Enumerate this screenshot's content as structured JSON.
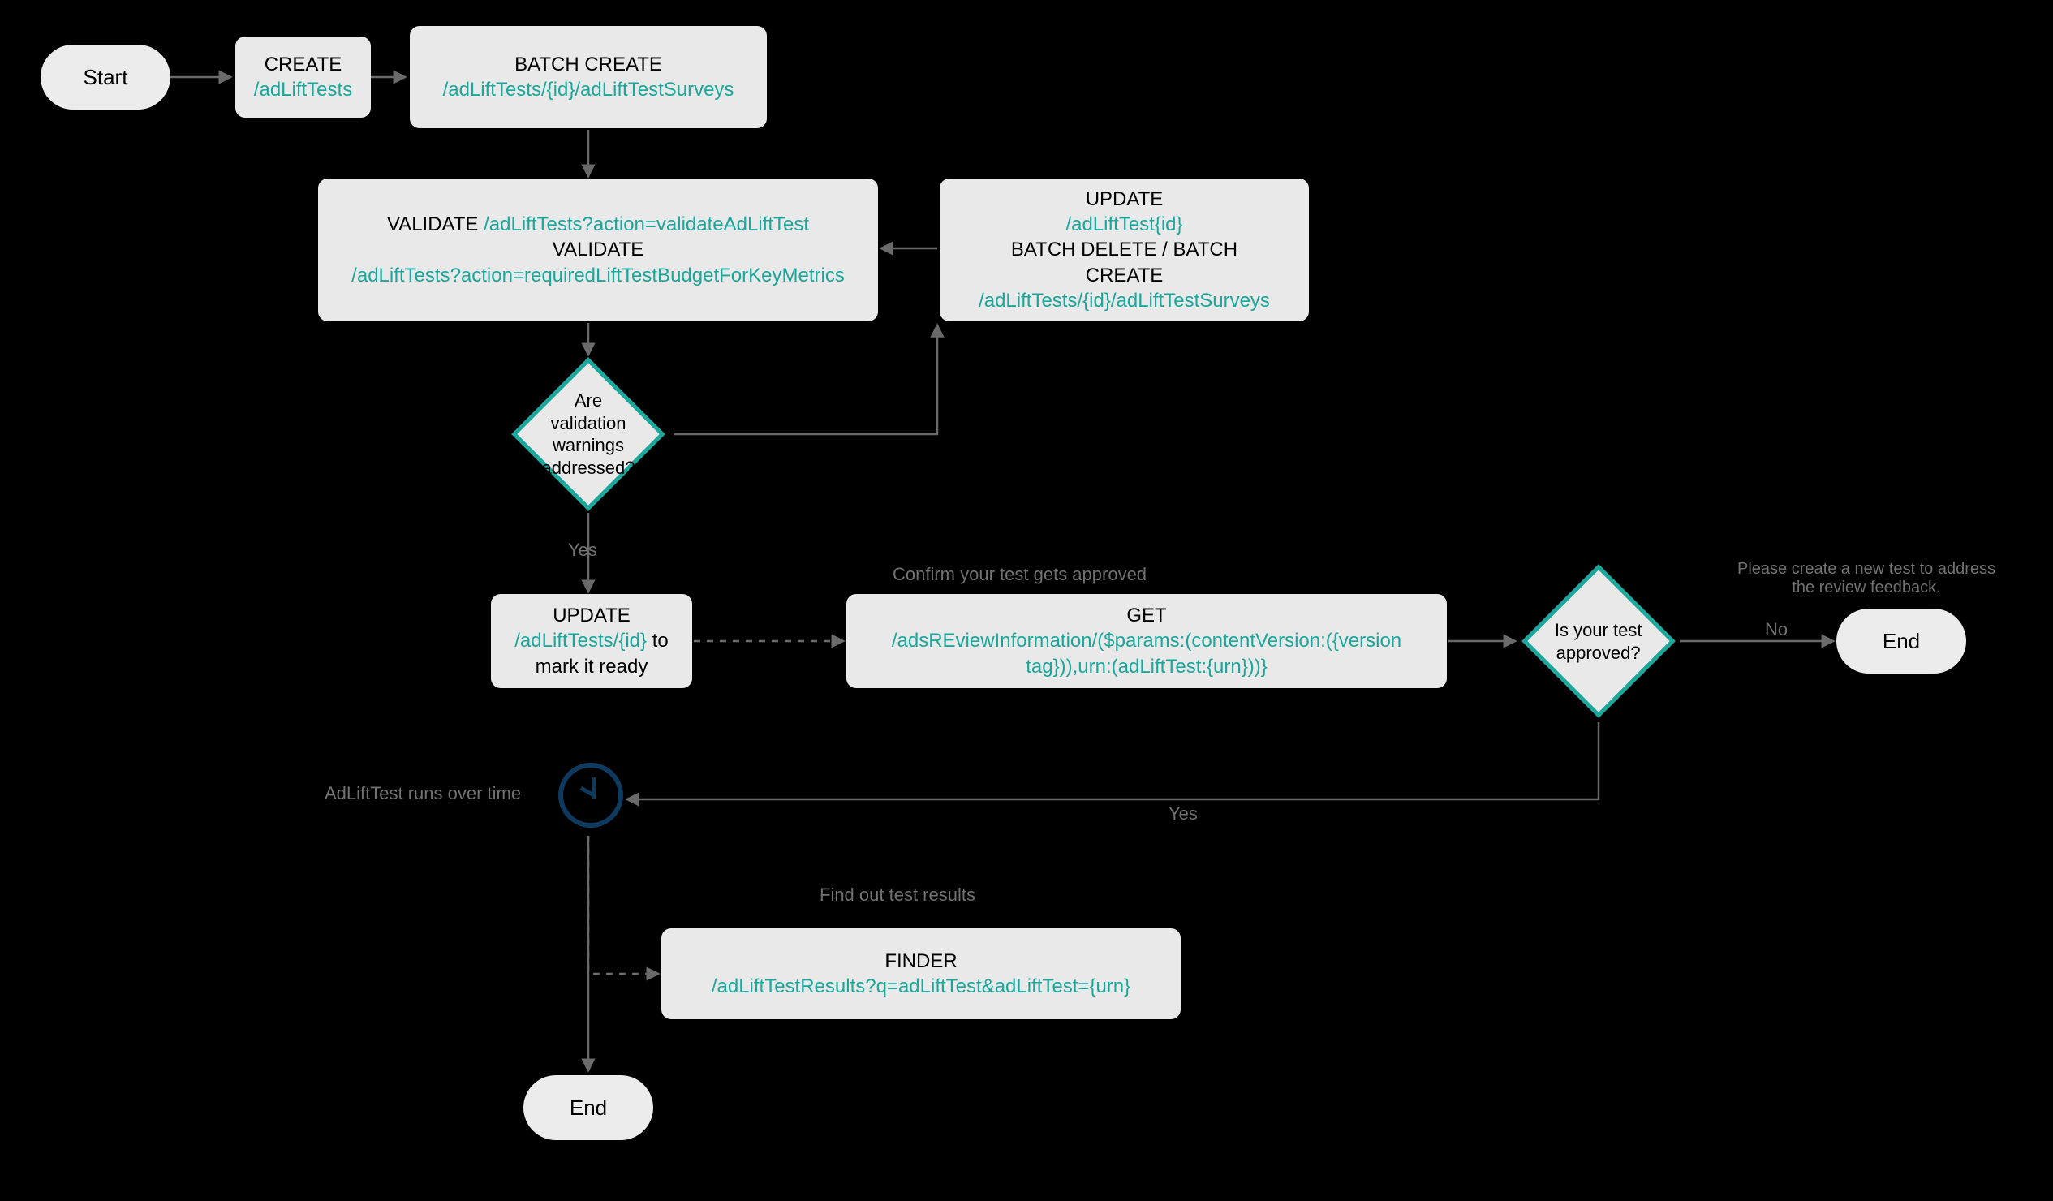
{
  "colors": {
    "bg": "#000000",
    "node_bg": "#e9e9e9",
    "accent": "#1aa79c",
    "edge": "#6a6a6a",
    "edge_dashed": "#6a6a6a",
    "label_gray": "#717171",
    "clock": "#0f3a5f"
  },
  "nodes": {
    "start": {
      "label": "Start"
    },
    "create": {
      "title": "CREATE",
      "path": "/adLiftTests"
    },
    "batch_create": {
      "title": "BATCH CREATE",
      "path": "/adLiftTests/{id}/adLiftTestSurveys"
    },
    "validate": {
      "line1_pre": "VALIDATE ",
      "line1_path": "/adLiftTests?action=validateAdLiftTest",
      "line2": "VALIDATE",
      "line3_path": "/adLiftTests?action=requiredLiftTestBudgetForKeyMetrics"
    },
    "update_batch": {
      "line1": "UPDATE",
      "line1_path": "/adLiftTest{id}",
      "line2": "BATCH DELETE / BATCH CREATE",
      "line2_path": "/adLiftTests/{id}/adLiftTestSurveys"
    },
    "decision_warnings": {
      "text": "Are validation warnings addressed?"
    },
    "update_ready": {
      "line1": "UPDATE",
      "path": "/adLiftTests/{id}",
      "suffix": " to mark it ready"
    },
    "get_review": {
      "line1": "GET",
      "path": "/adsREviewInformation/($params:(contentVersion:({version tag})),urn:(adLiftTest:{urn}))}"
    },
    "decision_approved": {
      "text": "Is your test approved?"
    },
    "end_right": {
      "label": "End"
    },
    "finder": {
      "line1": "FINDER",
      "path": "/adLiftTestResults?q=adLiftTest&adLiftTest={urn}"
    },
    "end_bottom": {
      "label": "End"
    }
  },
  "edge_labels": {
    "yes_down": "Yes",
    "confirm": "Confirm your test gets approved",
    "no_right": "No",
    "feedback": "Please create a new test to address the review feedback.",
    "yes_back": "Yes",
    "runs_over_time": "AdLiftTest runs over time",
    "find_results": "Find out test results"
  },
  "chart_data": {
    "type": "flowchart",
    "title": "",
    "nodes": [
      {
        "id": "start",
        "kind": "terminal",
        "label": "Start"
      },
      {
        "id": "create",
        "kind": "process",
        "label": "CREATE /adLiftTests"
      },
      {
        "id": "batch_create",
        "kind": "process",
        "label": "BATCH CREATE /adLiftTests/{id}/adLiftTestSurveys"
      },
      {
        "id": "validate",
        "kind": "process",
        "label": "VALIDATE /adLiftTests?action=validateAdLiftTest; VALIDATE /adLiftTests?action=requiredLiftTestBudgetForKeyMetrics"
      },
      {
        "id": "update_batch",
        "kind": "process",
        "label": "UPDATE /adLiftTest{id}; BATCH DELETE / BATCH CREATE /adLiftTests/{id}/adLiftTestSurveys"
      },
      {
        "id": "decision_warnings",
        "kind": "decision",
        "label": "Are validation warnings addressed?"
      },
      {
        "id": "update_ready",
        "kind": "process",
        "label": "UPDATE /adLiftTests/{id} to mark it ready"
      },
      {
        "id": "get_review",
        "kind": "process",
        "label": "GET /adsREviewInformation/($params:(contentVersion:({version tag})),urn:(adLiftTest:{urn}))}"
      },
      {
        "id": "decision_approved",
        "kind": "decision",
        "label": "Is your test approved?"
      },
      {
        "id": "end_right",
        "kind": "terminal",
        "label": "End"
      },
      {
        "id": "clock",
        "kind": "delay",
        "label": "AdLiftTest runs over time"
      },
      {
        "id": "finder",
        "kind": "process",
        "label": "FINDER /adLiftTestResults?q=adLiftTest&adLiftTest={urn}"
      },
      {
        "id": "end_bottom",
        "kind": "terminal",
        "label": "End"
      }
    ],
    "edges": [
      {
        "from": "start",
        "to": "create",
        "style": "solid"
      },
      {
        "from": "create",
        "to": "batch_create",
        "style": "solid"
      },
      {
        "from": "batch_create",
        "to": "validate",
        "style": "solid"
      },
      {
        "from": "validate",
        "to": "decision_warnings",
        "style": "solid"
      },
      {
        "from": "decision_warnings",
        "to": "update_batch",
        "label": "",
        "style": "solid"
      },
      {
        "from": "update_batch",
        "to": "validate",
        "style": "solid"
      },
      {
        "from": "decision_warnings",
        "to": "update_ready",
        "label": "Yes",
        "style": "solid"
      },
      {
        "from": "update_ready",
        "to": "get_review",
        "label": "Confirm your test gets approved",
        "style": "dashed"
      },
      {
        "from": "get_review",
        "to": "decision_approved",
        "style": "solid"
      },
      {
        "from": "decision_approved",
        "to": "end_right",
        "label": "No",
        "annotation": "Please create a new test to address the review feedback.",
        "style": "solid"
      },
      {
        "from": "decision_approved",
        "to": "clock",
        "label": "Yes",
        "style": "solid"
      },
      {
        "from": "clock",
        "to": "update_ready",
        "label": "AdLiftTest runs over time",
        "style": "back-ref"
      },
      {
        "from": "clock",
        "to": "finder",
        "label": "Find out test results",
        "style": "dashed"
      },
      {
        "from": "clock",
        "to": "end_bottom",
        "style": "solid"
      }
    ]
  }
}
